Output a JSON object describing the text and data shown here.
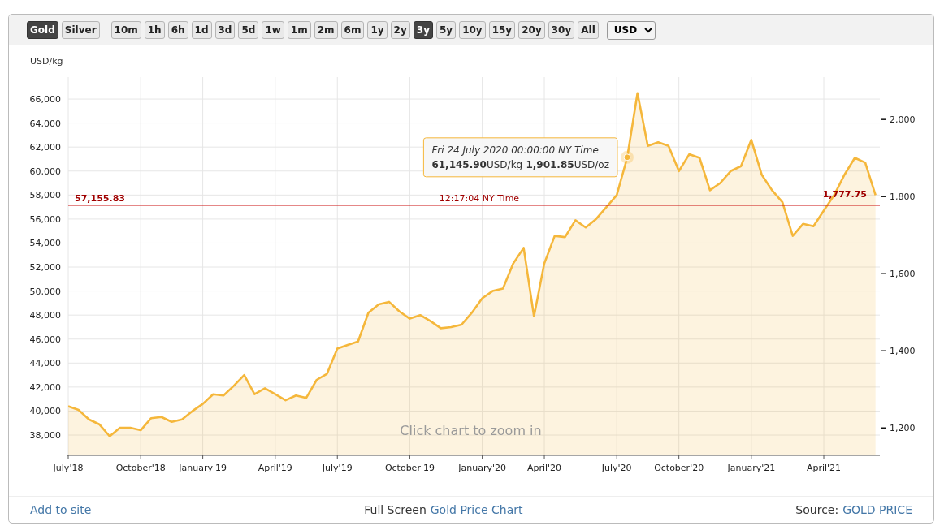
{
  "toolbar": {
    "metals": [
      {
        "label": "Gold",
        "selected": true
      },
      {
        "label": "Silver",
        "selected": false
      }
    ],
    "periods": [
      {
        "label": "10m",
        "selected": false
      },
      {
        "label": "1h",
        "selected": false
      },
      {
        "label": "6h",
        "selected": false
      },
      {
        "label": "1d",
        "selected": false
      },
      {
        "label": "3d",
        "selected": false
      },
      {
        "label": "5d",
        "selected": false
      },
      {
        "label": "1w",
        "selected": false
      },
      {
        "label": "1m",
        "selected": false
      },
      {
        "label": "2m",
        "selected": false
      },
      {
        "label": "6m",
        "selected": false
      },
      {
        "label": "1y",
        "selected": false
      },
      {
        "label": "2y",
        "selected": false
      },
      {
        "label": "3y",
        "selected": true
      },
      {
        "label": "5y",
        "selected": false
      },
      {
        "label": "10y",
        "selected": false
      },
      {
        "label": "15y",
        "selected": false
      },
      {
        "label": "20y",
        "selected": false
      },
      {
        "label": "30y",
        "selected": false
      },
      {
        "label": "All",
        "selected": false
      }
    ],
    "currency": "USD"
  },
  "chart": {
    "unit_label": "USD/kg",
    "hint": "Click chart to zoom in",
    "chart_data": {
      "type": "area",
      "grid": true,
      "ylim": [
        36310,
        67830
      ],
      "y2lim": [
        1129,
        2109.8
      ],
      "categories": [
        "July'18",
        null,
        null,
        null,
        null,
        null,
        null,
        "October'18",
        null,
        null,
        null,
        null,
        null,
        "January'19",
        null,
        null,
        null,
        null,
        null,
        null,
        "April'19",
        null,
        null,
        null,
        null,
        null,
        "July'19",
        null,
        null,
        null,
        null,
        null,
        null,
        "October'19",
        null,
        null,
        null,
        null,
        null,
        null,
        "January'20",
        null,
        null,
        null,
        null,
        null,
        "April'20",
        null,
        null,
        null,
        null,
        null,
        null,
        "July'20",
        null,
        null,
        null,
        null,
        null,
        "October'20",
        null,
        null,
        null,
        null,
        null,
        null,
        "January'21",
        null,
        null,
        null,
        null,
        null,
        null,
        "April'21",
        null,
        null,
        null,
        null,
        null
      ],
      "yticks": [
        {
          "value": 38000,
          "label": "38,000"
        },
        {
          "value": 40000,
          "label": "40,000"
        },
        {
          "value": 42000,
          "label": "42,000"
        },
        {
          "value": 44000,
          "label": "44,000"
        },
        {
          "value": 46000,
          "label": "46,000"
        },
        {
          "value": 48000,
          "label": "48,000"
        },
        {
          "value": 50000,
          "label": "50,000"
        },
        {
          "value": 52000,
          "label": "52,000"
        },
        {
          "value": 54000,
          "label": "54,000"
        },
        {
          "value": 56000,
          "label": "56,000"
        },
        {
          "value": 58000,
          "label": "58,000"
        },
        {
          "value": 60000,
          "label": "60,000"
        },
        {
          "value": 62000,
          "label": "62,000"
        },
        {
          "value": 64000,
          "label": "64,000"
        },
        {
          "value": 66000,
          "label": "66,000"
        }
      ],
      "y2ticks": [
        {
          "value": 1200,
          "label": "1,200"
        },
        {
          "value": 1400,
          "label": "1,400"
        },
        {
          "value": 1600,
          "label": "1,600"
        },
        {
          "value": 1800,
          "label": "1,800"
        },
        {
          "value": 2000,
          "label": "2,000"
        }
      ],
      "series": [
        {
          "color": "#f5b73b",
          "values": [
            40400,
            40100,
            39300,
            38900,
            37900,
            38600,
            38600,
            38400,
            39400,
            39500,
            39100,
            39300,
            40000,
            40600,
            41400,
            41300,
            42100,
            43000,
            41400,
            41900,
            41400,
            40900,
            41300,
            41100,
            42600,
            43100,
            45200,
            45500,
            45800,
            48200,
            48900,
            49100,
            48300,
            47700,
            48000,
            47500,
            46900,
            47000,
            47200,
            48200,
            49400,
            50000,
            50200,
            52300,
            53600,
            47900,
            52300,
            54600,
            54500,
            55900,
            55300,
            56000,
            57000,
            58000,
            61100,
            66500,
            62100,
            62400,
            62100,
            60000,
            61400,
            61100,
            58400,
            59000,
            60000,
            60400,
            62600,
            59700,
            58400,
            57400,
            54600,
            55600,
            55400,
            56700,
            58000,
            59700,
            61100,
            60700,
            58000
          ]
        }
      ],
      "ref_lines": [
        {
          "axis": "y",
          "value": 57155.83,
          "label": "57,155.83",
          "color": "#cc1010"
        }
      ],
      "annotations": [
        "Fri 24 July 2020 00:00:00 NY Time"
      ]
    },
    "price_line": {
      "time": "12:17:04 NY Time",
      "oz_price": "1,777.75"
    },
    "tooltip_values": {
      "kg_value": "61,145.90",
      "kg_unit": "USD/kg",
      "oz_value": "1,901.85",
      "oz_unit": "USD/oz"
    }
  },
  "footer": {
    "add_link": "Add to site",
    "center_text": "Full Screen",
    "center_link": "Gold Price Chart",
    "source_label": "Source:",
    "source_link": "GOLD PRICE"
  }
}
